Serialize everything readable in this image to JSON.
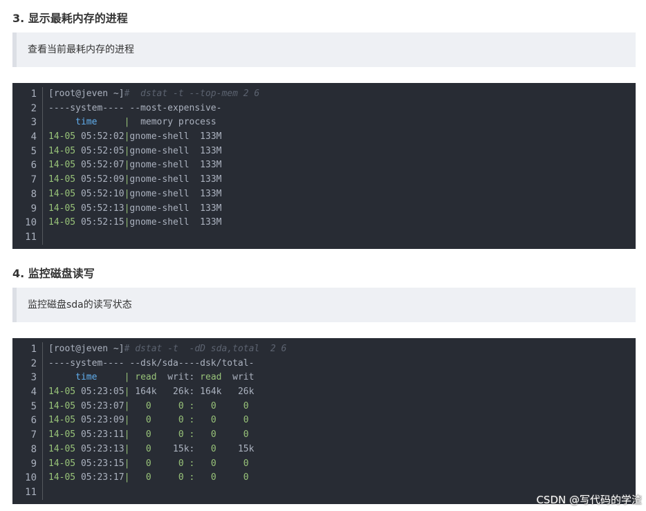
{
  "section3": {
    "heading": "3. 显示最耗内存的进程",
    "quote": "查看当前最耗内存的进程",
    "code": {
      "line_numbers": [
        "1",
        "2",
        "3",
        "4",
        "5",
        "6",
        "7",
        "8",
        "9",
        "10",
        "11"
      ],
      "prompt": "[root@jeven ~]",
      "prompt_hash": "#",
      "command": "  dstat -t --top-mem 2 6",
      "header1": "----system---- --most-expensive-",
      "header2_pre": "     ",
      "header2_time": "time",
      "header2_mid": "     ",
      "header2_sep": "|",
      "header2_post": "  memory process",
      "rows": [
        {
          "date": "14-05",
          "time": "05:52:02",
          "sep": "|",
          "rest": "gnome-shell  133M"
        },
        {
          "date": "14-05",
          "time": "05:52:05",
          "sep": "|",
          "rest": "gnome-shell  133M"
        },
        {
          "date": "14-05",
          "time": "05:52:07",
          "sep": "|",
          "rest": "gnome-shell  133M"
        },
        {
          "date": "14-05",
          "time": "05:52:09",
          "sep": "|",
          "rest": "gnome-shell  133M"
        },
        {
          "date": "14-05",
          "time": "05:52:10",
          "sep": "|",
          "rest": "gnome-shell  133M"
        },
        {
          "date": "14-05",
          "time": "05:52:13",
          "sep": "|",
          "rest": "gnome-shell  133M"
        },
        {
          "date": "14-05",
          "time": "05:52:15",
          "sep": "|",
          "rest": "gnome-shell  133M"
        }
      ]
    }
  },
  "section4": {
    "heading": "4. 监控磁盘读写",
    "quote": "监控磁盘sda的读写状态",
    "code": {
      "line_numbers": [
        "1",
        "2",
        "3",
        "4",
        "5",
        "6",
        "7",
        "8",
        "9",
        "10",
        "11"
      ],
      "prompt": "[root@jeven ~]",
      "prompt_hash": "#",
      "command": " dstat -t  -dD sda,total  2 6",
      "header1": "----system---- --dsk/sda----dsk/total-",
      "header2_pre": "     ",
      "header2_time": "time",
      "header2_mid": "     ",
      "header2_sep": "|",
      "header2_read1": " read",
      "header2_writ1": "  writ:",
      "header2_read2": " read",
      "header2_writ2": "  writ",
      "rows": [
        {
          "date": "14-05",
          "time": "05:23:05",
          "sep": "|",
          "v1": " 164k",
          "v2": "   26k:",
          "v3": " 164k",
          "v4": "   26k",
          "zero": false
        },
        {
          "date": "14-05",
          "time": "05:23:07",
          "sep": "|",
          "v1": "   0",
          "v2": "     0 :",
          "v3": "   0",
          "v4": "     0",
          "zero": true
        },
        {
          "date": "14-05",
          "time": "05:23:09",
          "sep": "|",
          "v1": "   0",
          "v2": "     0 :",
          "v3": "   0",
          "v4": "     0",
          "zero": true
        },
        {
          "date": "14-05",
          "time": "05:23:11",
          "sep": "|",
          "v1": "   0",
          "v2": "     0 :",
          "v3": "   0",
          "v4": "     0",
          "zero": true
        },
        {
          "date": "14-05",
          "time": "05:23:13",
          "sep": "|",
          "v1": "   0",
          "v2": "    15k:",
          "v3": "   0",
          "v4": "    15k",
          "zero": false
        },
        {
          "date": "14-05",
          "time": "05:23:15",
          "sep": "|",
          "v1": "   0",
          "v2": "     0 :",
          "v3": "   0",
          "v4": "     0",
          "zero": true
        },
        {
          "date": "14-05",
          "time": "05:23:17",
          "sep": "|",
          "v1": "   0",
          "v2": "     0 :",
          "v3": "   0",
          "v4": "     0",
          "zero": true
        }
      ]
    }
  },
  "watermark": "CSDN @写代码的学渣",
  "colors": {
    "code_bg": "#282c34",
    "quote_bg": "#eef0f4",
    "green": "#98c379",
    "blue": "#61afef"
  }
}
